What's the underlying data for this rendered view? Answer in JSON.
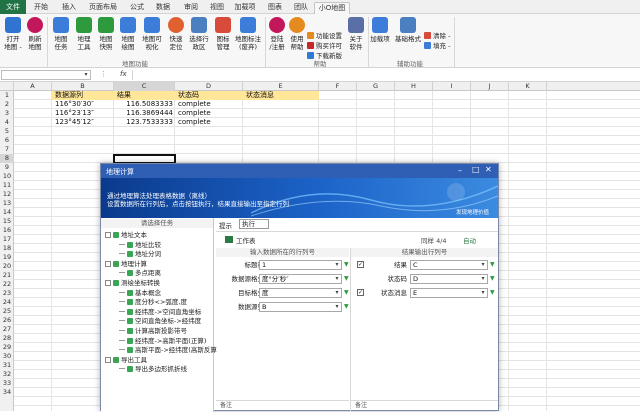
{
  "tabs": [
    "文件",
    "开始",
    "插入",
    "页面布局",
    "公式",
    "数据",
    "审阅",
    "视图",
    "加载项",
    "图表",
    "团队",
    "小O地图"
  ],
  "ribbon": {
    "open_map": "打开\n地图 -",
    "refresh_map": "刷新\n地图",
    "map_task": "地图\n任务",
    "map_tools": "地理\n工具",
    "map_quickshot": "地图\n快照",
    "map_draw": "地图\n绘图",
    "map_visualize": "地图可\n视化",
    "quick_locate": "快速\n定位",
    "select_region": "选择行\n政区",
    "icon_manage": "图标\n管理",
    "map_label": "地图标注\n(废弃)",
    "login": "登陆\n/注册",
    "help": "使用\n帮助",
    "feature_settings": "功能设置",
    "buy_license": "购买许可",
    "download_new": "下载新版",
    "about": "关于\n软件",
    "load_item": "加载项",
    "basic_format": "基础格式",
    "clear": "清除 -",
    "fill": "填充 -",
    "group_map_func": "地图功能",
    "group_help": "帮助",
    "group_aux": "辅助功能"
  },
  "formula_bar": {
    "fx": "fx",
    "namebox": ""
  },
  "columns": [
    "A",
    "B",
    "C",
    "D",
    "E",
    "F",
    "G",
    "H",
    "I",
    "J",
    "K"
  ],
  "rows": [
    "1",
    "2",
    "3",
    "4",
    "5",
    "6",
    "7",
    "8",
    "9",
    "10",
    "11",
    "12",
    "13",
    "14",
    "15",
    "16",
    "17",
    "18",
    "19",
    "20",
    "21",
    "22",
    "23",
    "24",
    "25",
    "26",
    "27",
    "28",
    "29",
    "30",
    "31",
    "32",
    "33",
    "34"
  ],
  "sheet": {
    "headers": [
      "数据源列",
      "结果",
      "状态码",
      "状态消息"
    ],
    "data": [
      [
        "116°30′30″",
        "116.5083333",
        "complete"
      ],
      [
        "116°23′13″",
        "116.3869444",
        "complete"
      ],
      [
        "123°45′12″",
        "123.7533333",
        "complete"
      ]
    ]
  },
  "dialog": {
    "title": "地理计算",
    "banner_line1": "通过地理算法处理表格数据（离线）",
    "banner_line2": "设置数据所在行列后，点击按钮执行，结果直接输出至指定行列",
    "banner_right": "发现地理价值",
    "left_header": "请选择任务",
    "tree": [
      {
        "t": "地址文本",
        "lvl": 0,
        "exp": true
      },
      {
        "t": "地址比较",
        "lvl": 1
      },
      {
        "t": "地址分词",
        "lvl": 1
      },
      {
        "t": "地理计算",
        "lvl": 0,
        "exp": true
      },
      {
        "t": "多点距离",
        "lvl": 1
      },
      {
        "t": "测绘坐标转换",
        "lvl": 0,
        "exp": true
      },
      {
        "t": "基本概念",
        "lvl": 1
      },
      {
        "t": "度分秒<>弧度,度",
        "lvl": 1
      },
      {
        "t": "经纬度->空间直角坐标",
        "lvl": 1
      },
      {
        "t": "空间直角坐标->经纬度",
        "lvl": 1
      },
      {
        "t": "计算高斯投影带号",
        "lvl": 1
      },
      {
        "t": "经纬度->高斯平面(正算)",
        "lvl": 1
      },
      {
        "t": "高斯平面->经纬度(高斯反算",
        "lvl": 1
      },
      {
        "t": "导出工具",
        "lvl": 0,
        "exp": true
      },
      {
        "t": "导出多边形抓折线",
        "lvl": 1
      }
    ],
    "hint": "提示",
    "exec": "执行",
    "worksheet": "工作表",
    "sheet_name": "同样 4/4",
    "auto": "自动",
    "input_header": "输入数据所在的行列号",
    "output_header": "结果输出行列号",
    "title_row_label": "标题行",
    "title_row_val": "1",
    "data_format_label": "数据源格式",
    "data_format_val": "度°分′秒″",
    "target_format_label": "目标格式",
    "target_format_val": "度",
    "data_col_label": "数据源列",
    "data_col_val": "B",
    "out_result_label": "结果",
    "out_result_val": "C",
    "out_status_label": "状态码",
    "out_status_val": "D",
    "out_msg_label": "状态消息",
    "out_msg_val": "E",
    "note_left": "备注",
    "note_right": "备注"
  },
  "colors": {
    "excel_green": "#217346",
    "header_yellow": "#ffe699",
    "dialog_blue": "#2e5fb5"
  }
}
